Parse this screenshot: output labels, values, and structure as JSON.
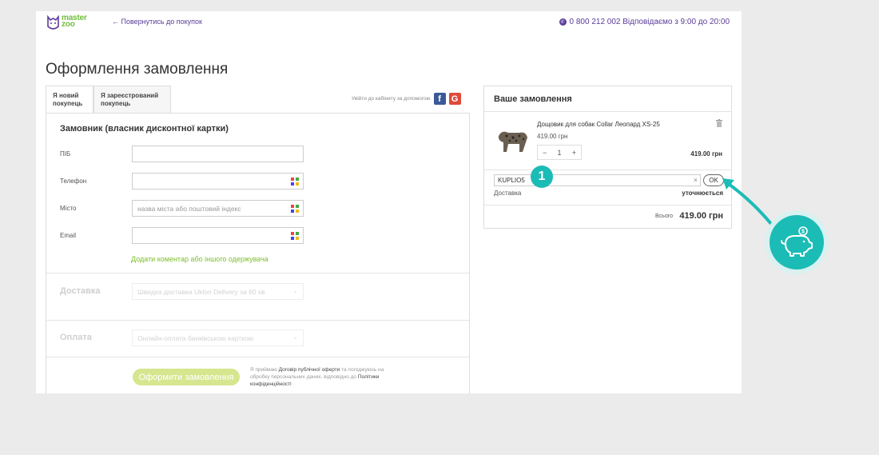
{
  "header": {
    "logo_line1": "master",
    "logo_line2": "zoo",
    "back_link": "← Повернутись до покупок",
    "phone": "0 800 212 002 Відповідаємо з 9:00 до 20:00"
  },
  "page_title": "Оформлення замовлення",
  "tabs": [
    {
      "label": "Я новий покупець"
    },
    {
      "label": "Я зареєстрований покупець"
    }
  ],
  "social_login_text": "Увійти до кабінету за допомогою",
  "customer_section": {
    "title": "Замовник (власник дисконтної картки)",
    "fields": [
      {
        "label": "ПІБ",
        "value": "",
        "placeholder": ""
      },
      {
        "label": "Телефон",
        "value": "",
        "placeholder": ""
      },
      {
        "label": "Місто",
        "value": "",
        "placeholder": "назва міста або поштовий індекс"
      },
      {
        "label": "Email",
        "value": "",
        "placeholder": ""
      }
    ],
    "add_comment_link": "Додати коментар або іншого одержувача"
  },
  "delivery_section": {
    "title": "Доставка",
    "selected": "Швидка доставка Uklon Delivery за 60 хв"
  },
  "payment_section": {
    "title": "Оплата",
    "selected": "Онлайн-оплата банківською карткою"
  },
  "submit_button": "Оформити замовлення",
  "terms": {
    "prefix": "Я приймаю",
    "offer_link": "Договір публічної оферти",
    "middle": "та погоджуюсь на обробку персональних даних, відповідно до",
    "privacy_link": "Політики конфіденційності"
  },
  "order": {
    "title": "Ваше замовлення",
    "product": {
      "name": "Дощовик для собак Collar Леопард XS-25",
      "price": "419.00 грн",
      "quantity": "1",
      "minus": "−",
      "plus": "+",
      "total": "419.00 грн"
    },
    "coupon_value": "KUPLIO5",
    "coupon_clear": "×",
    "ok_button": "OK",
    "delivery_label": "Доставка",
    "delivery_value": "уточнюється",
    "sum_label": "Всього",
    "sum_value": "419.00 грн"
  },
  "annotation": {
    "step_number": "1",
    "accent_color": "#1bbcb6"
  },
  "colors": {
    "brand_purple": "#5a3c9a",
    "brand_green": "#6fbe3b",
    "submit_disabled": "#d6e68f"
  }
}
